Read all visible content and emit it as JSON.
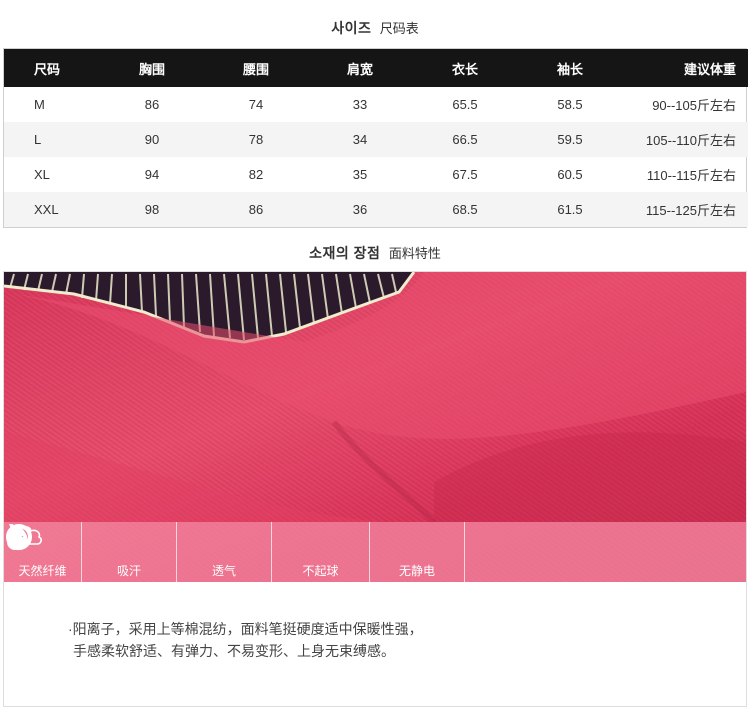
{
  "size_section": {
    "title_ko": "사이즈",
    "title_cn": "尺码表"
  },
  "size_table": {
    "headers": [
      "尺码",
      "胸围",
      "腰围",
      "肩宽",
      "衣长",
      "袖长",
      "建议体重"
    ],
    "rows": [
      [
        "M",
        "86",
        "74",
        "33",
        "65.5",
        "58.5",
        "90--105斤左右"
      ],
      [
        "L",
        "90",
        "78",
        "34",
        "66.5",
        "59.5",
        "105--110斤左右"
      ],
      [
        "XL",
        "94",
        "82",
        "35",
        "67.5",
        "60.5",
        "110--115斤左右"
      ],
      [
        "XXL",
        "98",
        "86",
        "36",
        "68.5",
        "61.5",
        "115--125斤左右"
      ]
    ]
  },
  "fabric_section": {
    "title_ko": "소재의 장점",
    "title_cn": "面料特性"
  },
  "features": [
    {
      "label": "天然纤维",
      "icon": "leaf-icon"
    },
    {
      "label": "吸汗",
      "icon": "water-drop-icon"
    },
    {
      "label": "透气",
      "icon": "cloud-icon"
    },
    {
      "label": "不起球",
      "icon": "ring-icon"
    },
    {
      "label": "无静电",
      "icon": "lightning-icon"
    }
  ],
  "description": {
    "line1": "·阳离子，采用上等棉混纺，面料笔挺硬度适中保暖性强，",
    "line2": "手感柔软舒适、有弹力、不易变形、上身无束缚感。"
  },
  "colors": {
    "header_bg": "#151515",
    "fabric": "#d93057",
    "feature_bar": "#f486a0"
  }
}
